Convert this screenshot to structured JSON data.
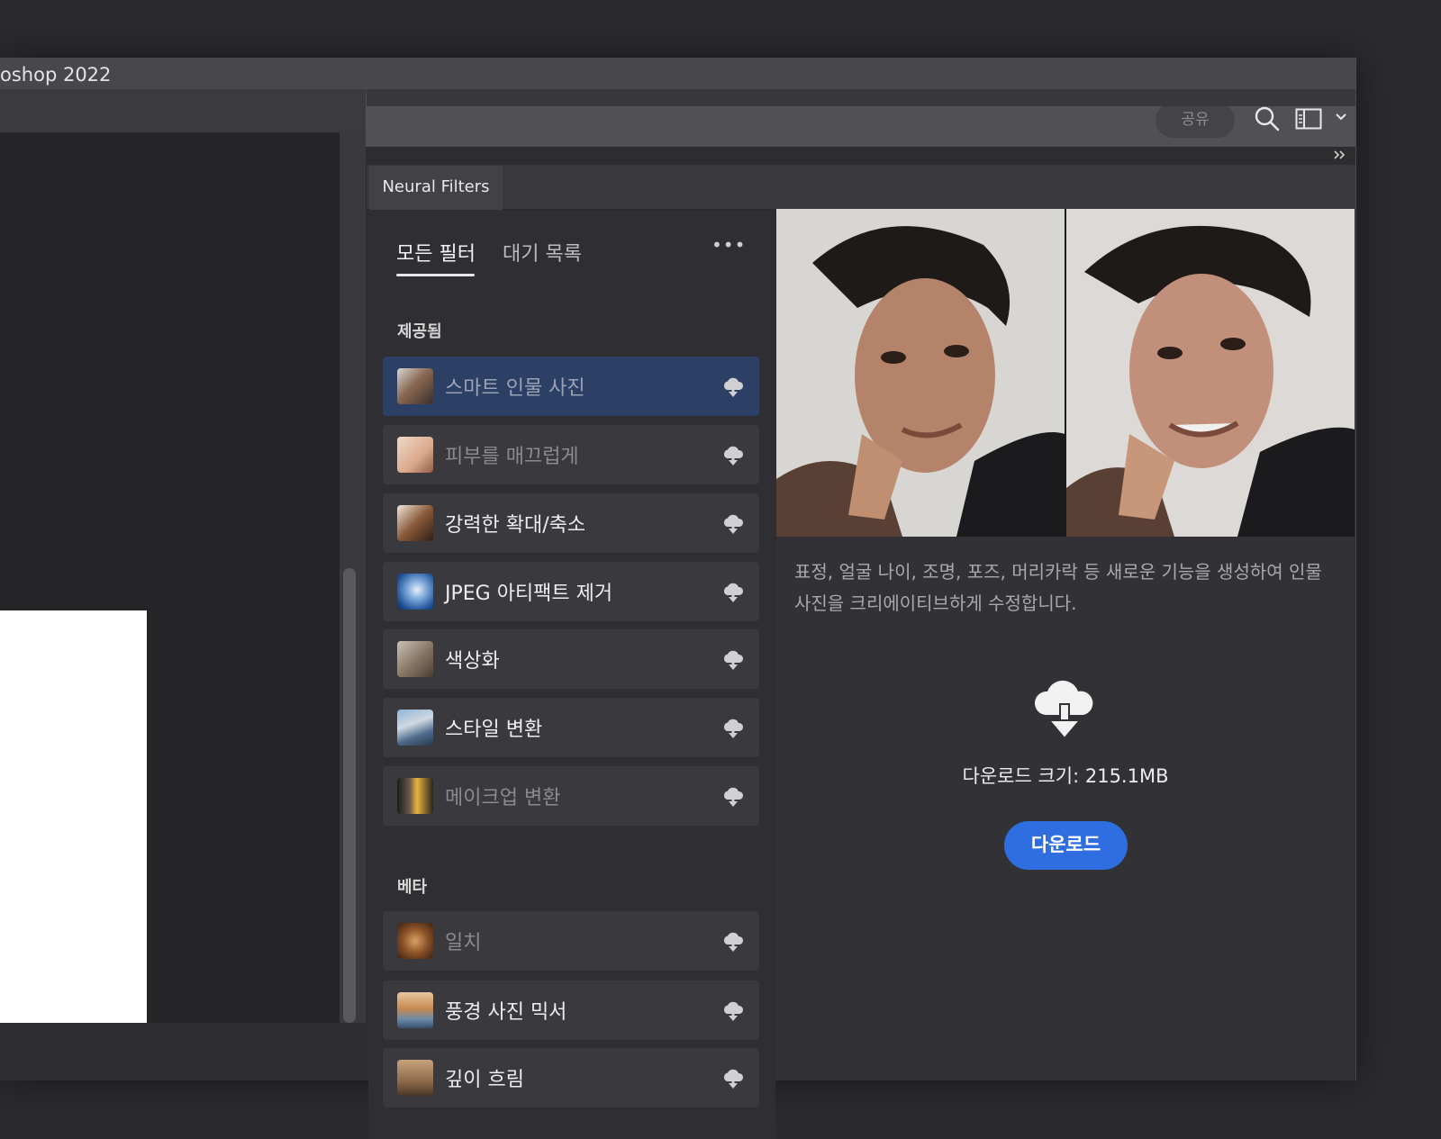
{
  "window": {
    "title": "oshop 2022"
  },
  "toolbar": {
    "share_label": "공유"
  },
  "panel": {
    "tab_label": "Neural Filters",
    "tabs": [
      {
        "label": "모든 필터"
      },
      {
        "label": "대기 목록"
      }
    ],
    "more_label": "•••",
    "sections": {
      "featured": "제공됨",
      "beta": "베타"
    },
    "featured_filters": [
      {
        "label": "스마트 인물 사진",
        "icon": "portrait-thumb"
      },
      {
        "label": "피부를 매끄럽게",
        "icon": "skin-thumb"
      },
      {
        "label": "강력한 확대/축소",
        "icon": "zoom-thumb"
      },
      {
        "label": "JPEG 아티팩트 제거",
        "icon": "jpeg-thumb"
      },
      {
        "label": "색상화",
        "icon": "colorize-thumb"
      },
      {
        "label": "스타일 변환",
        "icon": "style-thumb"
      },
      {
        "label": "메이크업 변환",
        "icon": "makeup-thumb"
      }
    ],
    "beta_filters": [
      {
        "label": "일치",
        "icon": "match-thumb"
      },
      {
        "label": "풍경 사진 믹서",
        "icon": "landscape-thumb"
      },
      {
        "label": "깊이 흐림",
        "icon": "depth-thumb"
      }
    ]
  },
  "detail": {
    "description": "표정, 얼굴 나이, 조명, 포즈, 머리카락 등 새로운 기능을 생성하여 인물 사진을 크리에이티브하게 수정합니다.",
    "download_size": "다운로드 크기: 215.1MB",
    "download_label": "다운로드"
  },
  "colors": {
    "selected_item": "#2c4066",
    "download_button": "#2f6ee0"
  }
}
